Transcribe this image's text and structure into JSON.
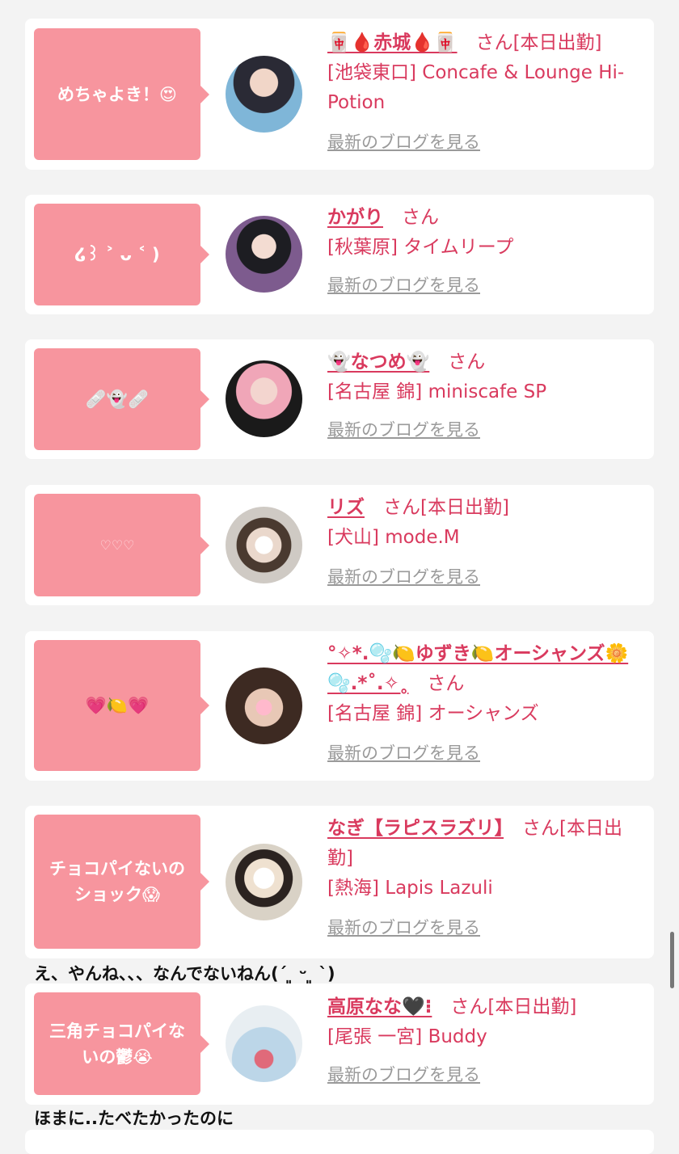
{
  "honorific": "さん",
  "blog_link": "最新のブログを見る",
  "cards": [
    {
      "bubble": "めちゃよき！😍",
      "name": "🀄🩸赤城🩸🀄",
      "status": "[本日出勤]",
      "shop": "[池袋東口] Concafe & Lounge Hi-Potion"
    },
    {
      "bubble": "໒꒱ ˃ ᴗ ˂ )",
      "name": "かがり",
      "status": "",
      "shop": "[秋葉原] タイムリープ"
    },
    {
      "bubble": "🩹👻🩹",
      "name": "👻なつめ👻",
      "status": "",
      "shop": "[名古屋 錦] miniscafe SP"
    },
    {
      "bubble": "♡♡♡",
      "name": "リズ",
      "status": "[本日出勤]",
      "shop": "[犬山] mode.M"
    },
    {
      "bubble": "💗🍋💗",
      "name": "°✧*.🫧🍋ゆずき🍋オーシャンズ🌼🫧.*˚.✧˳",
      "status": "",
      "shop": "[名古屋 錦] オーシャンズ"
    },
    {
      "bubble": "チョコパイないのショック😱",
      "name": "なぎ【ラピスラズリ】",
      "status": "[本日出勤]",
      "shop": "[熱海] Lapis Lazuli"
    },
    {
      "bubble": "三角チョコパイないの鬱😭",
      "name": "高原なな🖤⁝",
      "status": "[本日出勤]",
      "shop": "[尾張 一宮] Buddy"
    }
  ],
  "comments": [
    "え、やんね、、、なんでないねん(´ ͈ ᵕ ͈ `)",
    "ほまに..たべたかったのに"
  ],
  "colors": {
    "bubble": "#f7959e",
    "accent": "#d93a5e",
    "link": "#9a9a9a",
    "background": "#f3f3f3"
  }
}
